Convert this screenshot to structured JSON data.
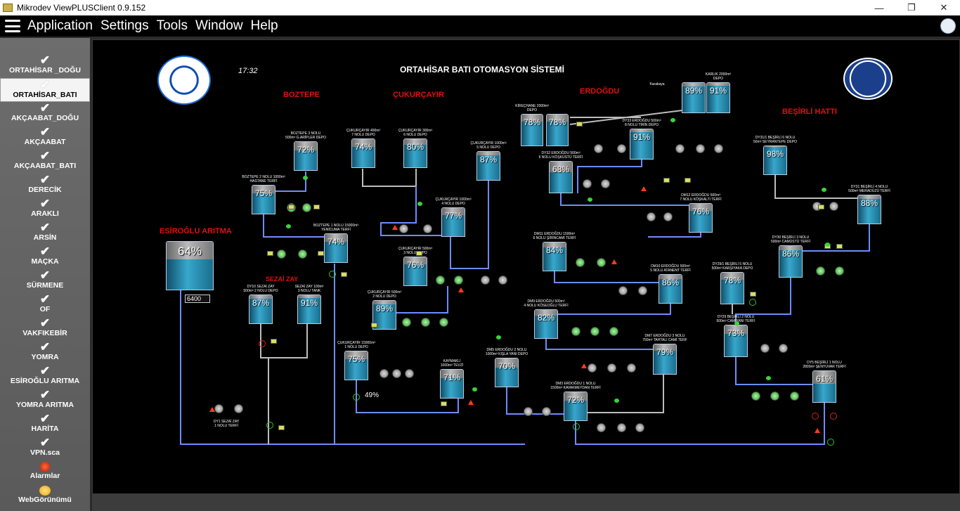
{
  "window": {
    "title": "Mikrodev ViewPLUSClient 0.9.152",
    "minimize": "—",
    "maximize": "❐",
    "close": "✕"
  },
  "menu": [
    "Application",
    "Settings",
    "Tools",
    "Window",
    "Help"
  ],
  "sidebar": [
    {
      "label": "ORTAHİSAR _DOĞU"
    },
    {
      "label": "ORTAHİSAR_BATI",
      "active": true
    },
    {
      "label": "AKÇAABAT_DOĞU"
    },
    {
      "label": "AKÇAABAT"
    },
    {
      "label": "AKÇAABAT_BATI"
    },
    {
      "label": "DERECİK"
    },
    {
      "label": "ARAKLI"
    },
    {
      "label": "ARSİN"
    },
    {
      "label": "MAÇKA"
    },
    {
      "label": "SÜRMENE"
    },
    {
      "label": "OF"
    },
    {
      "label": "VAKFIKEBİR"
    },
    {
      "label": "YOMRA"
    },
    {
      "label": "ESİROĞLU ARITMA"
    },
    {
      "label": "YOMRA ARITMA"
    },
    {
      "label": "HARİTA"
    },
    {
      "label": "VPN.sca"
    },
    {
      "label": "Alarmlar",
      "icon": "bell-icon"
    },
    {
      "label": "WebGörünümü",
      "icon": "cloud-icon"
    }
  ],
  "scada": {
    "title": "ORTAHİSAR BATI OTOMASYON SİSTEMİ",
    "clock": "17:32",
    "flow_value": "6400",
    "flow_value_2": "49%",
    "regions": {
      "boztepe": "BOZTEPE",
      "cukurcayir": "ÇUKURÇAYIR",
      "erdogdu": "ERDOĞDU",
      "besirli": "BEŞİRLİ HATTI",
      "esiroglu": "ESİROĞLU ARITMA",
      "sezaizay": "SEZAİ ZAY"
    },
    "tanks": [
      {
        "id": "esiroglu",
        "pct": 64,
        "label": ""
      },
      {
        "id": "boztepe3",
        "pct": 72,
        "label": "BOZTEPE 3 NOLU\n500m³ G.ARİPLER DEPO"
      },
      {
        "id": "boztepe2",
        "pct": 75,
        "label": "BOZTEPE 2 NOLU 1000m³\nHASTANE TERFİ"
      },
      {
        "id": "boztepe1",
        "pct": 74,
        "label": "BOZTEPE 1 NOLU 15000m³\nYENİCUMA TERFİ"
      },
      {
        "id": "dy10",
        "pct": 87,
        "label": "DY10 SEZAİ ZAY\n500m³ 2 NOLU DEPO"
      },
      {
        "id": "sezaizay100",
        "pct": 91,
        "label": "SEZAİ ZAY 100m³\n3 NOLU TANK"
      },
      {
        "id": "cuk7",
        "pct": 74,
        "label": "ÇUKURÇAYIR 400m³\n7 NOLU DEPO"
      },
      {
        "id": "cuk6",
        "pct": 80,
        "label": "ÇUKURÇAYIR 300m³\n6 NOLU DEPO"
      },
      {
        "id": "cuk5",
        "pct": 87,
        "label": "ÇUKURÇAYIR 1000m³\n5 NOLU DEPO"
      },
      {
        "id": "cuk4",
        "pct": 77,
        "label": "ÇUKURÇAYIR 1000m³\n4 NOLU DEPO"
      },
      {
        "id": "cuk3",
        "pct": 76,
        "label": "ÇUKURÇAYIR 500m³\n3 NOLU DEPO"
      },
      {
        "id": "cuk2",
        "pct": 89,
        "label": "ÇUKURÇAYIR 500m³\n2 NOLU DEPO"
      },
      {
        "id": "cuk1",
        "pct": 75,
        "label": "ÇUKURÇAYIR 15000m³\n1 NOLU DEPO"
      },
      {
        "id": "kaymakli",
        "pct": 71,
        "label": "KAYMAKLI\n1000m³ TEVZİ"
      },
      {
        "id": "kirechane1",
        "pct": 78,
        "label": "KİREÇHANE 2000m³\nDEPO"
      },
      {
        "id": "kirechane2",
        "pct": 78,
        "label": ""
      },
      {
        "id": "karlik1",
        "pct": 89,
        "label": ""
      },
      {
        "id": "karlik2",
        "pct": 91,
        "label": "KARLIK 2000m³\nDEPO"
      },
      {
        "id": "dy33",
        "pct": 91,
        "label": "DY33 ERDOĞDU 500m³\n8 NOLU TİRİN DEPO"
      },
      {
        "id": "dy32",
        "pct": 68,
        "label": "DY32 ERDOĞDU 500m³\n6 NOLU KÖŞKÜSTÜ TERFİ"
      },
      {
        "id": "dm12",
        "pct": 76,
        "label": "DM12 ERDOĞDU 500m³\n7 NOLU KÖŞKALTI TERFİ"
      },
      {
        "id": "dm11",
        "pct": 84,
        "label": "DM11 ERDOĞDU 1500m³\n6 NOLU ŞİRİNCAMİ TERFİ"
      },
      {
        "id": "dm10",
        "pct": 86,
        "label": "DM10 ERDOĞDU 500m³\n5 NOLU ATANENT TERFİ"
      },
      {
        "id": "dm9",
        "pct": 82,
        "label": "DM9 ERDOĞDU 500m³\n4 NOLU KÖSEOĞLU TERFİ"
      },
      {
        "id": "dm7",
        "pct": 79,
        "label": "DM7 ERDOĞDU 3 NOLU\n750m³ TAHTALI CAMİ TERF"
      },
      {
        "id": "dm5",
        "pct": 70,
        "label": "DM5 ERDOĞDU 2 NOLU\n1000m³ KIŞLA YANI DEPO"
      },
      {
        "id": "dm3",
        "pct": 72,
        "label": "DM3 ERDOĞDU 1 NOLU\n1500m³ KAVAKMEYDAN TERFİ"
      },
      {
        "id": "dy31",
        "pct": 98,
        "label": "DY31/1 BEŞİRLİ 6 NOLU\n50m³ SEYRANTEPE DEPO"
      },
      {
        "id": "dy31b",
        "pct": 88,
        "label": "DY31 BEŞİRLİ 4 NOLU\n500m³ MERADÜZÜ TERFİ"
      },
      {
        "id": "dy30",
        "pct": 86,
        "label": "DY30 BEŞİRLİ 3 NOLU\n500m³ CAMÜSTÜ TERFİ"
      },
      {
        "id": "dy29_1",
        "pct": 78,
        "label": "DY29/1 BEŞİRLİ 5 NOLU\n500m³ KARŞIYAKA DEPO"
      },
      {
        "id": "dy29",
        "pct": 73,
        "label": "DY29 BEŞİRLİ 2 NOLU\n500m³ CAMİYANI TERFİ"
      },
      {
        "id": "dy5",
        "pct": 61,
        "label": "DY5 BEŞİRLİ 1 NOLU\n2800m³ ŞENYUVAR TERFİ"
      }
    ],
    "misc_labels": {
      "karakaya": "Karakaya",
      "dy1": "DY1 SEZAİ ZAY\n1 NOLU TERFİ"
    }
  },
  "colors": {
    "pipe": "#6e8cff",
    "pipe_grey": "#bdbdbd",
    "title": "#ffffff",
    "region": "#e01010"
  }
}
